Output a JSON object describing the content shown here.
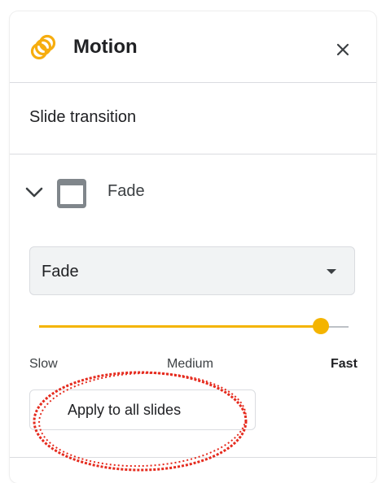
{
  "panel": {
    "title": "Motion",
    "logo_icon": "motion-rings-icon",
    "close_icon": "close-icon"
  },
  "section": {
    "title": "Slide transition"
  },
  "transition": {
    "name": "Fade",
    "expand_icon": "chevron-down-icon",
    "thumbnail_icon": "slide-thumbnail-icon"
  },
  "select": {
    "value": "Fade",
    "caret_icon": "caret-down-icon"
  },
  "speed": {
    "labels": [
      "Slow",
      "Medium",
      "Fast"
    ],
    "level": 0.91,
    "accent_color": "#f4b400"
  },
  "apply_button": {
    "label": "Apply to all slides"
  },
  "annotation": {
    "color": "#e52b1e"
  }
}
